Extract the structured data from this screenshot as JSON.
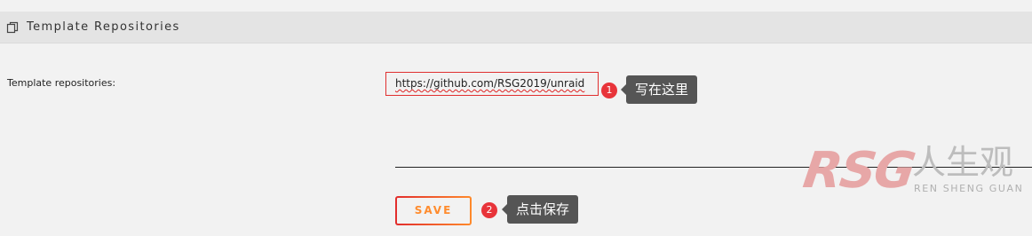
{
  "section": {
    "title": "Template Repositories",
    "icon": "copy-icon"
  },
  "form": {
    "repositories_label": "Template repositories:",
    "repositories_value": "https://github.com/RSG2019/unraid"
  },
  "actions": {
    "save_label": "SAVE"
  },
  "annotations": [
    {
      "number": "1",
      "text": "写在这里"
    },
    {
      "number": "2",
      "text": "点击保存"
    }
  ],
  "watermark": {
    "brand": "RSG",
    "chinese": "人生观",
    "english": "REN SHENG GUAN"
  },
  "colors": {
    "accent_orange": "#ff8c2e",
    "accent_red": "#e22d2d",
    "badge_red": "#e8343a",
    "callout_gray": "#555555"
  }
}
